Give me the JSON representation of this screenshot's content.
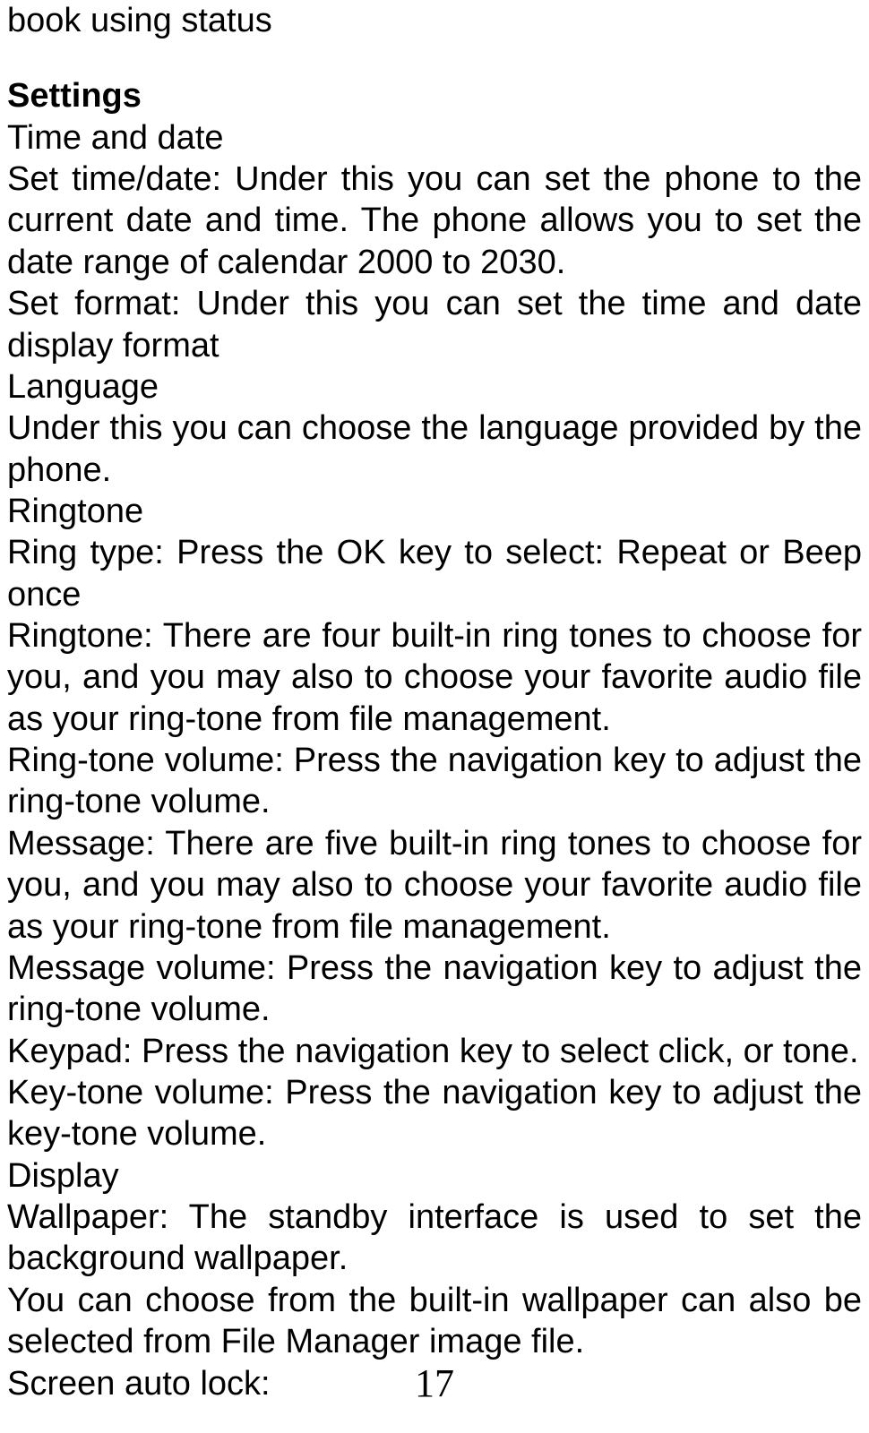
{
  "orphan_line": "book using status",
  "heading": "Settings",
  "time_date_title": "Time and date",
  "set_time_date": "Set time/date: Under this you can set the phone to the current date and time. The phone allows you to set the date range of calendar 2000 to 2030.",
  "set_format": "Set format: Under this you can set the time and date display format",
  "language_title": "Language",
  "language_body": "Under this you can choose the language provided by the phone.",
  "ringtone_title": "Ringtone",
  "ring_type": "Ring type: Press the OK key to select: Repeat or Beep once",
  "ringtone_body": "Ringtone: There are four built-in ring tones to choose for you, and you may also to choose your favorite audio file as your ring-tone from file management.",
  "ring_volume": "Ring-tone volume: Press the navigation key to adjust the ring-tone volume.",
  "message_body": "Message: There are five built-in ring tones to choose for you, and you may also to choose your favorite audio file as your ring-tone from file management.",
  "message_volume": "Message volume: Press the navigation key to adjust the ring-tone volume.",
  "keypad": "Keypad: Press the navigation key to select click, or tone.",
  "key_tone_volume": "Key-tone volume: Press the navigation key to adjust the key-tone volume.",
  "display_title": "Display",
  "wallpaper_body": "Wallpaper: The standby interface is used to set the background wallpaper.",
  "wallpaper_body2": "You can choose from the built-in wallpaper can also be selected from File Manager image file.",
  "screen_auto_lock": "Screen auto lock:",
  "page_number": "17"
}
